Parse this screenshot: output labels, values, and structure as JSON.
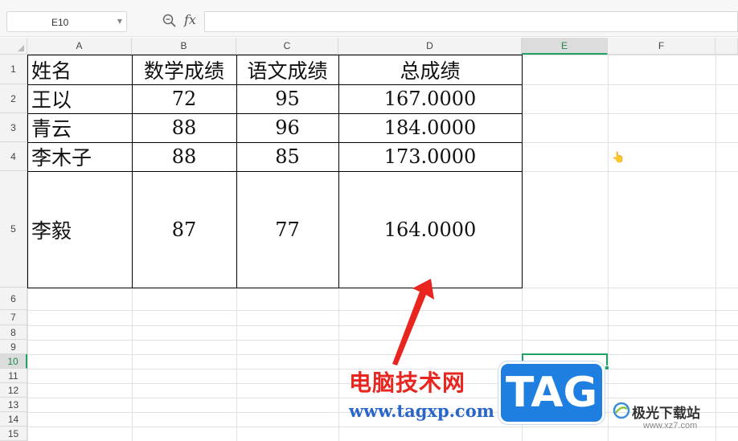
{
  "formula_bar": {
    "name_box": "E10",
    "fx_label": "fx",
    "formula": ""
  },
  "columns": [
    "A",
    "B",
    "C",
    "D",
    "E",
    "F"
  ],
  "rows": [
    "1",
    "2",
    "3",
    "4",
    "5",
    "6",
    "7",
    "8",
    "9",
    "10",
    "11",
    "12",
    "13",
    "14",
    "15"
  ],
  "active_cell": "E10",
  "table": {
    "header": [
      "姓名",
      "数学成绩",
      "语文成绩",
      "总成绩"
    ],
    "rows": [
      [
        "王以",
        "72",
        "95",
        "167.0000"
      ],
      [
        "青云",
        "88",
        "96",
        "184.0000"
      ],
      [
        "李木子",
        "88",
        "85",
        "173.0000"
      ],
      [
        "李毅",
        "87",
        "77",
        "164.0000"
      ]
    ]
  },
  "icons": {
    "zoom": "zoom-formula-icon",
    "cursor": "hand-cursor-icon",
    "corner": "select-all-icon"
  },
  "colors": {
    "accent_green": "#21a366",
    "arrow_red": "#e8251f",
    "tag_blue": "#1f7fe0"
  },
  "watermark": {
    "site_name": "电脑技术网",
    "url": "www.tagxp.com",
    "tag": "TAG",
    "brand": "极光下载站",
    "brand_url": "www.xz7.com"
  }
}
